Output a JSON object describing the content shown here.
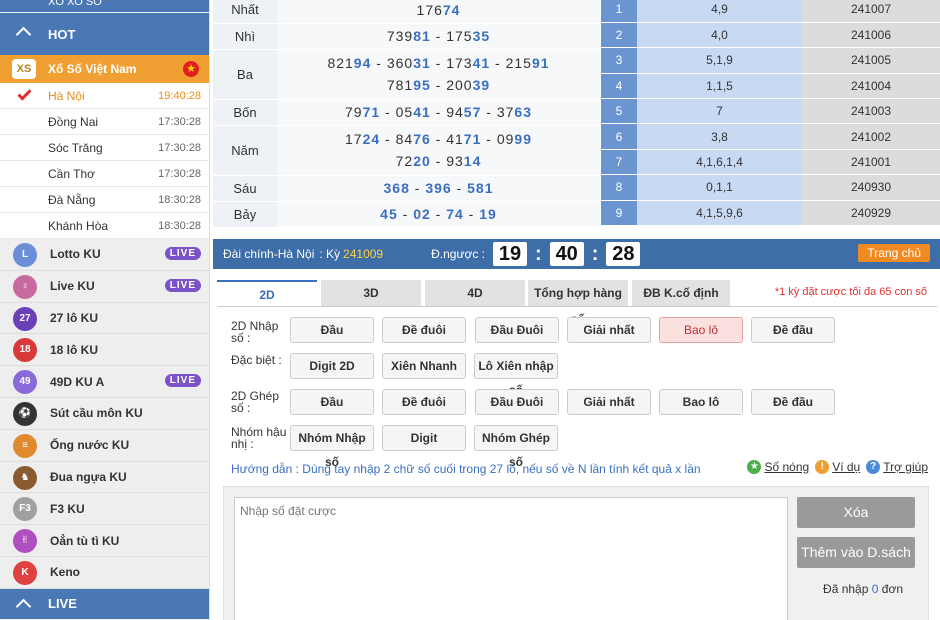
{
  "sidebar": {
    "top_label": "XỔ XỐ SỐ",
    "hot_label": "HOT",
    "vn_label": "Xổ Số Việt Nam",
    "vn_icon_text": "XS",
    "provinces": [
      {
        "name": "Hà Nội",
        "time": "19:40:28",
        "active": true
      },
      {
        "name": "Đồng Nai",
        "time": "17:30:28"
      },
      {
        "name": "Sóc Trăng",
        "time": "17:30:28"
      },
      {
        "name": "Cần Thơ",
        "time": "17:30:28"
      },
      {
        "name": "Đà Nẵng",
        "time": "18:30:28"
      },
      {
        "name": "Khánh Hòa",
        "time": "18:30:28"
      }
    ],
    "games": [
      {
        "name": "Lotto KU",
        "live": "LIVE",
        "icon": "lotto-icon",
        "color": "#6a8fd8",
        "glyph": "L"
      },
      {
        "name": "Live KU",
        "live": "LIVE",
        "icon": "live-host-icon",
        "color": "#c86aa0",
        "glyph": "♀"
      },
      {
        "name": "27 lô KU",
        "icon": "27-lo-icon",
        "color": "#6a3fb8",
        "glyph": "27"
      },
      {
        "name": "18 lô KU",
        "icon": "18-lo-icon",
        "color": "#d83a3a",
        "glyph": "18"
      },
      {
        "name": "49D KU A",
        "live": "LIVE",
        "icon": "49d-icon",
        "color": "#8a6ad8",
        "glyph": "49"
      },
      {
        "name": "Sút cầu môn KU",
        "icon": "soccer-icon",
        "color": "#333333",
        "glyph": "⚽"
      },
      {
        "name": "Ống nước KU",
        "icon": "pipe-icon",
        "color": "#e08a30",
        "glyph": "≡"
      },
      {
        "name": "Đua ngựa KU",
        "icon": "horse-icon",
        "color": "#8a5a30",
        "glyph": "♞"
      },
      {
        "name": "F3 KU",
        "icon": "f3-icon",
        "color": "#a0a0a0",
        "glyph": "F3"
      },
      {
        "name": "Oẳn tù tì KU",
        "icon": "rps-icon",
        "color": "#b050c0",
        "glyph": "✌"
      },
      {
        "name": "Keno",
        "icon": "keno-icon",
        "color": "#e04040",
        "glyph": "K"
      }
    ],
    "live_label": "LIVE"
  },
  "results": {
    "rows": [
      {
        "label": "Nhất",
        "lines": [
          [
            [
              "176",
              "74"
            ]
          ]
        ]
      },
      {
        "label": "Nhì",
        "lines": [
          [
            [
              "739",
              "81"
            ],
            [
              "175",
              "35"
            ]
          ]
        ]
      },
      {
        "label": "Ba",
        "lines": [
          [
            [
              "821",
              "94"
            ],
            [
              "360",
              "31"
            ],
            [
              "173",
              "41"
            ],
            [
              "215",
              "91"
            ]
          ],
          [
            [
              "781",
              "95"
            ],
            [
              "200",
              "39"
            ]
          ]
        ]
      },
      {
        "label": "Bốn",
        "lines": [
          [
            [
              "79",
              "71"
            ],
            [
              "05",
              "41"
            ],
            [
              "94",
              "57"
            ],
            [
              "37",
              "63"
            ]
          ]
        ]
      },
      {
        "label": "Năm",
        "lines": [
          [
            [
              "17",
              "24"
            ],
            [
              "84",
              "76"
            ],
            [
              "41",
              "71"
            ],
            [
              "09",
              "99"
            ]
          ],
          [
            [
              "72",
              "20"
            ],
            [
              "93",
              "14"
            ]
          ]
        ]
      },
      {
        "label": "Sáu",
        "lines": [
          [
            [
              "",
              "368"
            ],
            [
              "",
              "396"
            ],
            [
              "",
              "581"
            ]
          ]
        ]
      },
      {
        "label": "Bảy",
        "lines": [
          [
            [
              "",
              "45"
            ],
            [
              "",
              "02"
            ],
            [
              "",
              "74"
            ],
            [
              "",
              "19"
            ]
          ]
        ]
      }
    ]
  },
  "stats": [
    {
      "idx": "1",
      "nums": "4,9",
      "period": "241007"
    },
    {
      "idx": "2",
      "nums": "4,0",
      "period": "241006"
    },
    {
      "idx": "3",
      "nums": "5,1,9",
      "period": "241005"
    },
    {
      "idx": "4",
      "nums": "1,1,5",
      "period": "241004"
    },
    {
      "idx": "5",
      "nums": "7",
      "period": "241003"
    },
    {
      "idx": "6",
      "nums": "3,8",
      "period": "241002"
    },
    {
      "idx": "7",
      "nums": "4,1,6,1,4",
      "period": "241001"
    },
    {
      "idx": "8",
      "nums": "0,1,1",
      "period": "240930"
    },
    {
      "idx": "9",
      "nums": "4,1,5,9,6",
      "period": "240929"
    }
  ],
  "bar": {
    "station_label": "Đài chính-Hà Nội",
    "period_prefix": ": Kỳ",
    "period_value": "241009",
    "countdown_label": "Đ.ngược :",
    "hh": "19",
    "mm": "40",
    "ss": "28",
    "home_label": "Trang chủ"
  },
  "tabs": [
    "2D",
    "3D",
    "4D",
    "Tổng hợp hàng số",
    "ĐB K.cố định"
  ],
  "tab_note": "*1 kỳ đặt cược tối đa 65 con số",
  "bet_rows": [
    {
      "label": "2D Nhập số :",
      "buttons": [
        "Đầu",
        "Đề đuôi",
        "Đầu Đuôi",
        "Giải nhất",
        "Bao lô",
        "Đề đầu"
      ],
      "selected": 4
    },
    {
      "label": "Đặc biệt :",
      "buttons": [
        "Digit 2D",
        "Xiên Nhanh",
        "Lô Xiên nhập số"
      ]
    },
    {
      "label": "2D Ghép số :",
      "buttons": [
        "Đầu",
        "Đề đuôi",
        "Đầu Đuôi",
        "Giải nhất",
        "Bao lô",
        "Đề đầu"
      ]
    },
    {
      "label": "Nhóm hậu nhị :",
      "buttons": [
        "Nhóm Nhập số",
        "Digit",
        "Nhóm Ghép số"
      ]
    }
  ],
  "guide": "Hướng dẫn : Dùng tay nhập 2 chữ số cuối trong 27 lô, nếu số về N lần tính kết quả x lần",
  "links": {
    "hot": "Số nóng",
    "example": "Ví dụ",
    "help": "Trợ giúp"
  },
  "entry": {
    "placeholder": "Nhập số đặt cược",
    "delete_label": "Xóa",
    "add_label": "Thêm vào D.sách",
    "entered_prefix": "Đã nhập",
    "entered_count": "0",
    "entered_suffix": "đơn"
  },
  "colors": {
    "primary": "#4a78b5",
    "accent": "#f08a22",
    "live": "#7b52c8"
  }
}
